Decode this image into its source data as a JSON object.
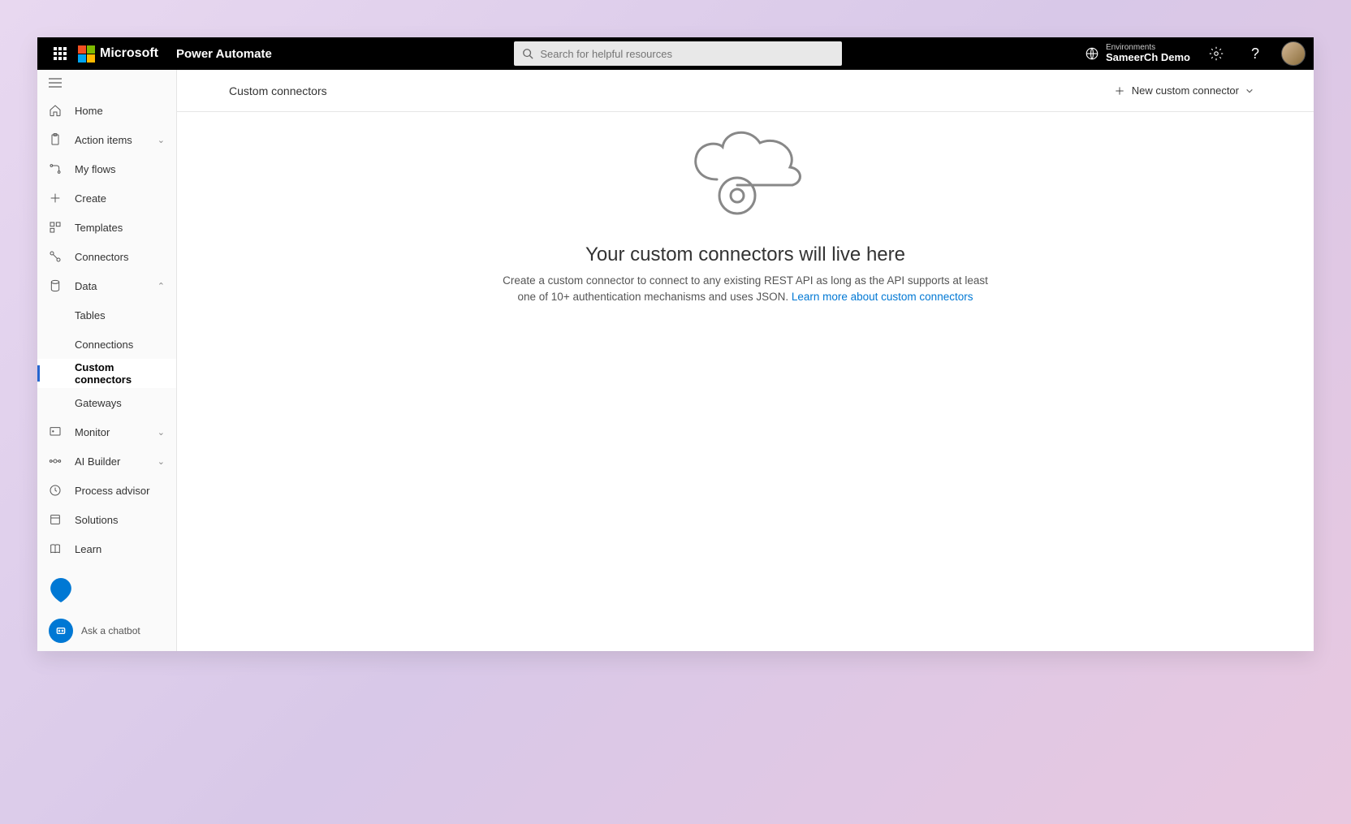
{
  "header": {
    "brand": "Microsoft",
    "app_name": "Power Automate",
    "search_placeholder": "Search for helpful resources",
    "environments_label": "Environments",
    "environment_name": "SameerCh Demo"
  },
  "command_bar": {
    "title": "Custom connectors",
    "new_button": "New custom connector"
  },
  "sidebar": {
    "items": [
      {
        "label": "Home"
      },
      {
        "label": "Action items",
        "expandable": true
      },
      {
        "label": "My flows"
      },
      {
        "label": "Create"
      },
      {
        "label": "Templates"
      },
      {
        "label": "Connectors"
      },
      {
        "label": "Data",
        "expandable": true,
        "expanded": true,
        "children": [
          {
            "label": "Tables"
          },
          {
            "label": "Connections"
          },
          {
            "label": "Custom connectors",
            "selected": true
          },
          {
            "label": "Gateways"
          }
        ]
      },
      {
        "label": "Monitor",
        "expandable": true
      },
      {
        "label": "AI Builder",
        "expandable": true
      },
      {
        "label": "Process advisor"
      },
      {
        "label": "Solutions"
      },
      {
        "label": "Learn"
      }
    ],
    "chatbot": "Ask a chatbot"
  },
  "empty_state": {
    "title": "Your custom connectors will live here",
    "description": "Create a custom connector to connect to any existing REST API as long as the API supports at least one of 10+ authentication mechanisms and uses JSON. ",
    "link_text": "Learn more about custom connectors"
  }
}
